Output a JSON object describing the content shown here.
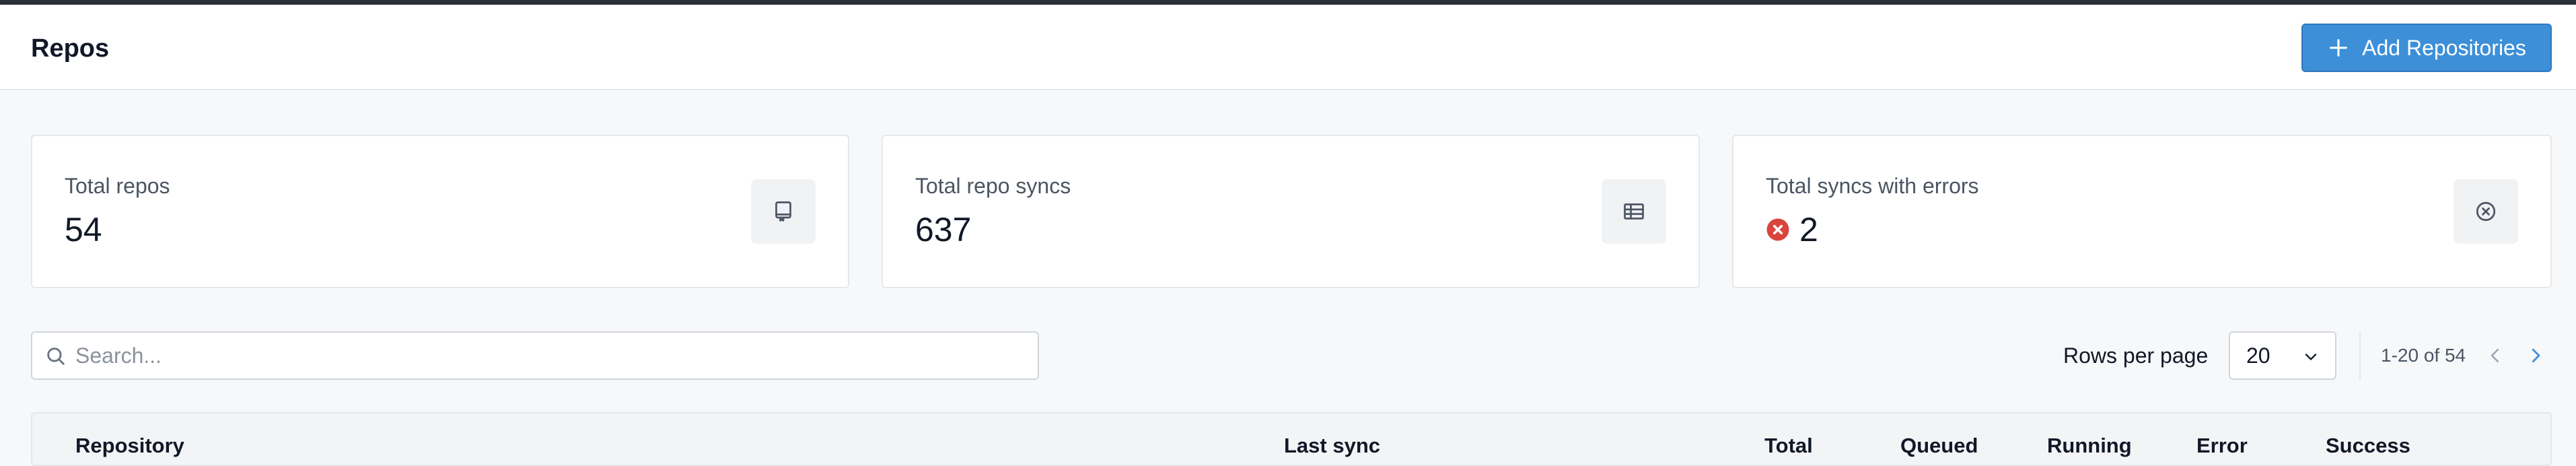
{
  "header": {
    "title": "Repos",
    "add_button_label": "Add Repositories"
  },
  "stats": [
    {
      "label": "Total repos",
      "value": "54",
      "icon": "repo-icon"
    },
    {
      "label": "Total repo syncs",
      "value": "637",
      "icon": "table-icon"
    },
    {
      "label": "Total syncs with errors",
      "value": "2",
      "icon": "x-circle-icon",
      "status_color": "#d9453d"
    }
  ],
  "search": {
    "placeholder": "Search...",
    "value": ""
  },
  "pagination": {
    "rows_per_page_label": "Rows per page",
    "rows_per_page": "20",
    "range": "1-20 of 54"
  },
  "table": {
    "columns": [
      "Repository",
      "Last sync",
      "Total",
      "Queued",
      "Running",
      "Error",
      "Success"
    ]
  },
  "colors": {
    "accent": "#3d8fd8",
    "error": "#d9453d"
  }
}
